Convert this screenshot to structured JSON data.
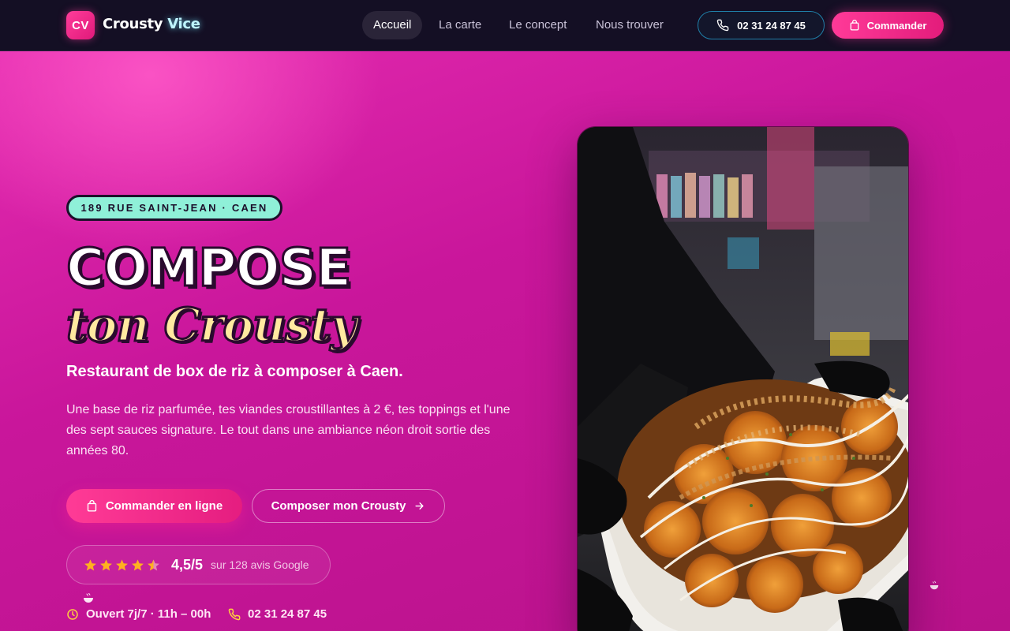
{
  "brand": {
    "badge": "CV",
    "name_part1": "Crousty",
    "name_part2": "Vice"
  },
  "nav": {
    "links": [
      {
        "label": "Accueil",
        "active": true
      },
      {
        "label": "La carte",
        "active": false
      },
      {
        "label": "Le concept",
        "active": false
      },
      {
        "label": "Nous trouver",
        "active": false
      }
    ],
    "phone": "02 31 24 87 45",
    "order_label": "Commander"
  },
  "hero": {
    "address": "189 RUE SAINT-JEAN · CAEN",
    "title_line1": "COMPOSE",
    "title_line2": "ton Crousty",
    "subtitle": "Restaurant de box de riz à composer à Caen.",
    "description": "Une base de riz parfumée, tes viandes croustillantes à 2 €, tes toppings et l'une des sept sauces signature. Le tout dans une ambiance néon droit sortie des années 80.",
    "cta_primary": "Commander en ligne",
    "cta_secondary": "Composer mon Crousty",
    "rating": {
      "score_label": "4,5/5",
      "stars": 4.5,
      "count_label": "sur 128 avis Google"
    },
    "hours": "Ouvert 7j/7 · 11h – 00h",
    "phone": "02 31 24 87 45"
  },
  "colors": {
    "accent_pink": "#ff3a98",
    "nav_bg": "#140f24",
    "mint": "#8ff0d8",
    "yellow": "#ffe9a0",
    "star": "#ffb020"
  },
  "icons": {
    "phone": "phone-icon",
    "bag": "shopping-bag-icon",
    "arrow": "arrow-right-icon",
    "star": "star-icon",
    "clock": "clock-icon",
    "bowl": "rice-bowl-icon"
  }
}
